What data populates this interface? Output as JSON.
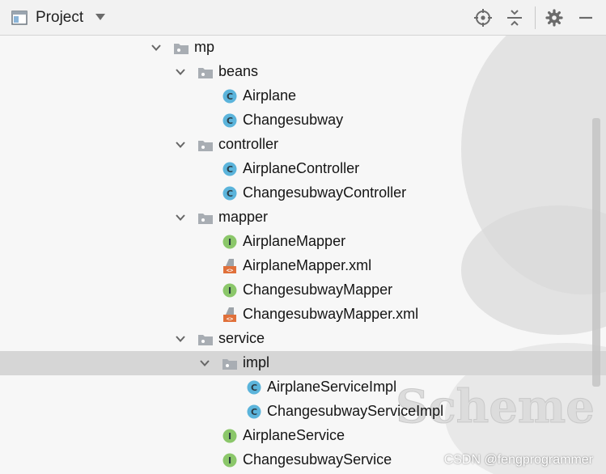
{
  "toolbar": {
    "view_label": "Project",
    "icons": [
      "project-view-icon",
      "dropdown-caret-icon",
      "locate-icon",
      "collapse-all-icon",
      "gear-icon",
      "hide-icon"
    ]
  },
  "tree": {
    "rows": [
      {
        "label": "mp",
        "type": "package",
        "depth": 0,
        "expanded": true
      },
      {
        "label": "beans",
        "type": "package",
        "depth": 1,
        "expanded": true
      },
      {
        "label": "Airplane",
        "type": "class",
        "depth": 2
      },
      {
        "label": "Changesubway",
        "type": "class",
        "depth": 2
      },
      {
        "label": "controller",
        "type": "package",
        "depth": 1,
        "expanded": true
      },
      {
        "label": "AirplaneController",
        "type": "class",
        "depth": 2
      },
      {
        "label": "ChangesubwayController",
        "type": "class",
        "depth": 2
      },
      {
        "label": "mapper",
        "type": "package",
        "depth": 1,
        "expanded": true
      },
      {
        "label": "AirplaneMapper",
        "type": "interface",
        "depth": 2
      },
      {
        "label": "AirplaneMapper.xml",
        "type": "xml",
        "depth": 2
      },
      {
        "label": "ChangesubwayMapper",
        "type": "interface",
        "depth": 2
      },
      {
        "label": "ChangesubwayMapper.xml",
        "type": "xml",
        "depth": 2
      },
      {
        "label": "service",
        "type": "package",
        "depth": 1,
        "expanded": true
      },
      {
        "label": "impl",
        "type": "package",
        "depth": 2,
        "expanded": true,
        "selected": true
      },
      {
        "label": "AirplaneServiceImpl",
        "type": "class",
        "depth": 3
      },
      {
        "label": "ChangesubwayServiceImpl",
        "type": "class",
        "depth": 3
      },
      {
        "label": "AirplaneService",
        "type": "interface",
        "depth": 2
      },
      {
        "label": "ChangesubwayService",
        "type": "interface",
        "depth": 2
      }
    ]
  },
  "background_text": "Scheme",
  "watermark": "CSDN @fengprogrammer",
  "colors": {
    "class_icon": "#5bb4db",
    "interface_icon": "#8bc76a",
    "xml_icon": "#e0703a",
    "folder_icon": "#a8adb3",
    "selected_row": "#d6d6d6"
  }
}
